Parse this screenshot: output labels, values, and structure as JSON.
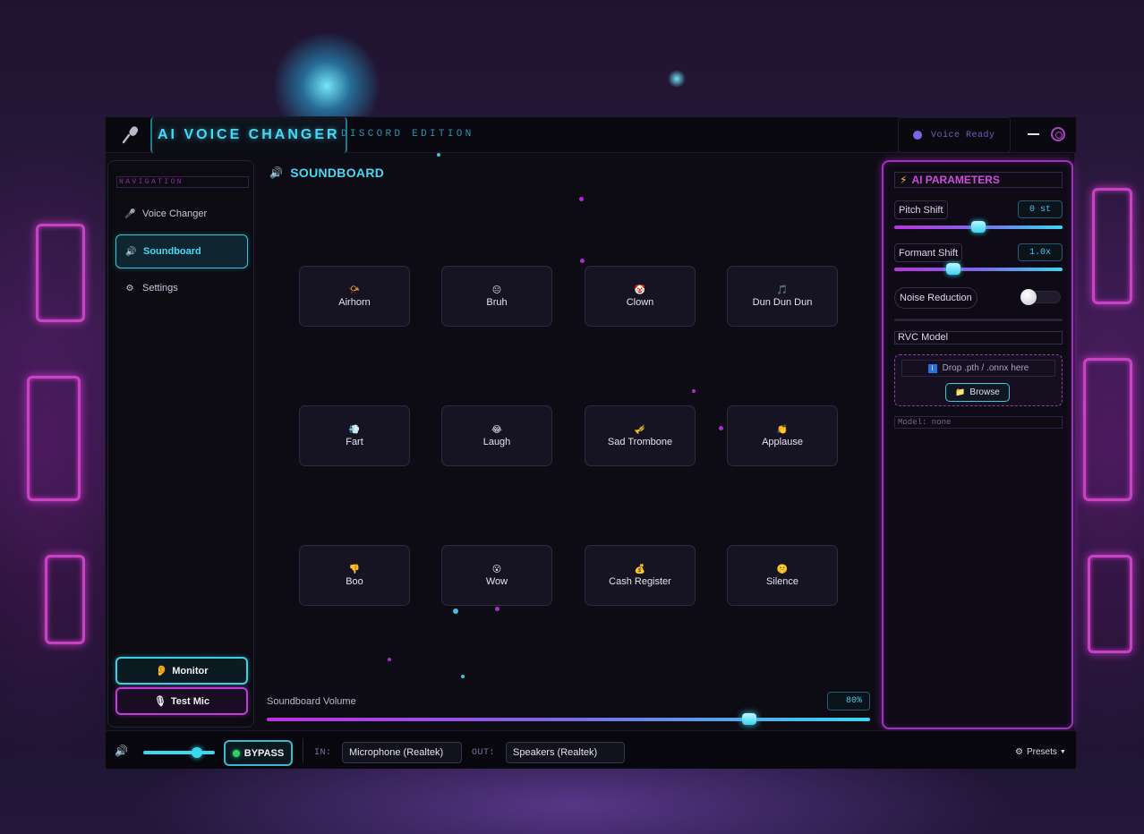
{
  "header": {
    "title": "AI VOICE CHANGER",
    "subtitle": "DISCORD EDITION",
    "status": "Voice Ready",
    "icons": [
      "microphone-icon",
      "minimize-icon",
      "close-icon"
    ]
  },
  "sidebar": {
    "heading": "NAVIGATION",
    "items": [
      {
        "label": "Voice Changer",
        "icon": "microphone-icon",
        "active": false
      },
      {
        "label": "Soundboard",
        "icon": "speaker-icon",
        "active": true
      },
      {
        "label": "Settings",
        "icon": "gear-icon",
        "active": false
      }
    ],
    "monitor_label": "Monitor",
    "test_mic_label": "Test Mic"
  },
  "soundboard": {
    "title": "SOUNDBOARD",
    "pads": [
      {
        "label": "Airhorn",
        "emoji": "📯"
      },
      {
        "label": "Bruh",
        "emoji": "😐"
      },
      {
        "label": "Clown",
        "emoji": "🤡"
      },
      {
        "label": "Dun Dun Dun",
        "emoji": "🎵"
      },
      {
        "label": "Fart",
        "emoji": "💨"
      },
      {
        "label": "Laugh",
        "emoji": "😂"
      },
      {
        "label": "Sad Trombone",
        "emoji": "🎺"
      },
      {
        "label": "Applause",
        "emoji": "👏"
      },
      {
        "label": "Boo",
        "emoji": "👎"
      },
      {
        "label": "Wow",
        "emoji": "😮"
      },
      {
        "label": "Cash Register",
        "emoji": "💰"
      },
      {
        "label": "Silence",
        "emoji": "🤫"
      }
    ],
    "volume_label": "Soundboard Volume",
    "volume_value": "80%",
    "volume_fraction": 0.8
  },
  "ai_params": {
    "title": "AI PARAMETERS",
    "pitch_label": "Pitch Shift",
    "pitch_value": "0 st",
    "pitch_fraction": 0.5,
    "formant_label": "Formant Shift",
    "formant_value": "1.0x",
    "formant_fraction": 0.35,
    "noise_label": "Noise Reduction",
    "noise_enabled": false,
    "rvc_label": "RVC Model",
    "drop_text": "Drop .pth / .onnx here",
    "browse_label": "Browse",
    "model_status": "Model: none"
  },
  "bottom": {
    "master_volume_fraction": 0.75,
    "bypass_label": "BYPASS",
    "in_label": "IN:",
    "in_device": "Microphone (Realtek)",
    "out_label": "OUT:",
    "out_device": "Speakers (Realtek)",
    "presets_label": "Presets"
  },
  "colors": {
    "accent_cyan": "#46d9f5",
    "accent_magenta": "#c23ad8",
    "bypass_on": "#2ed06a"
  }
}
